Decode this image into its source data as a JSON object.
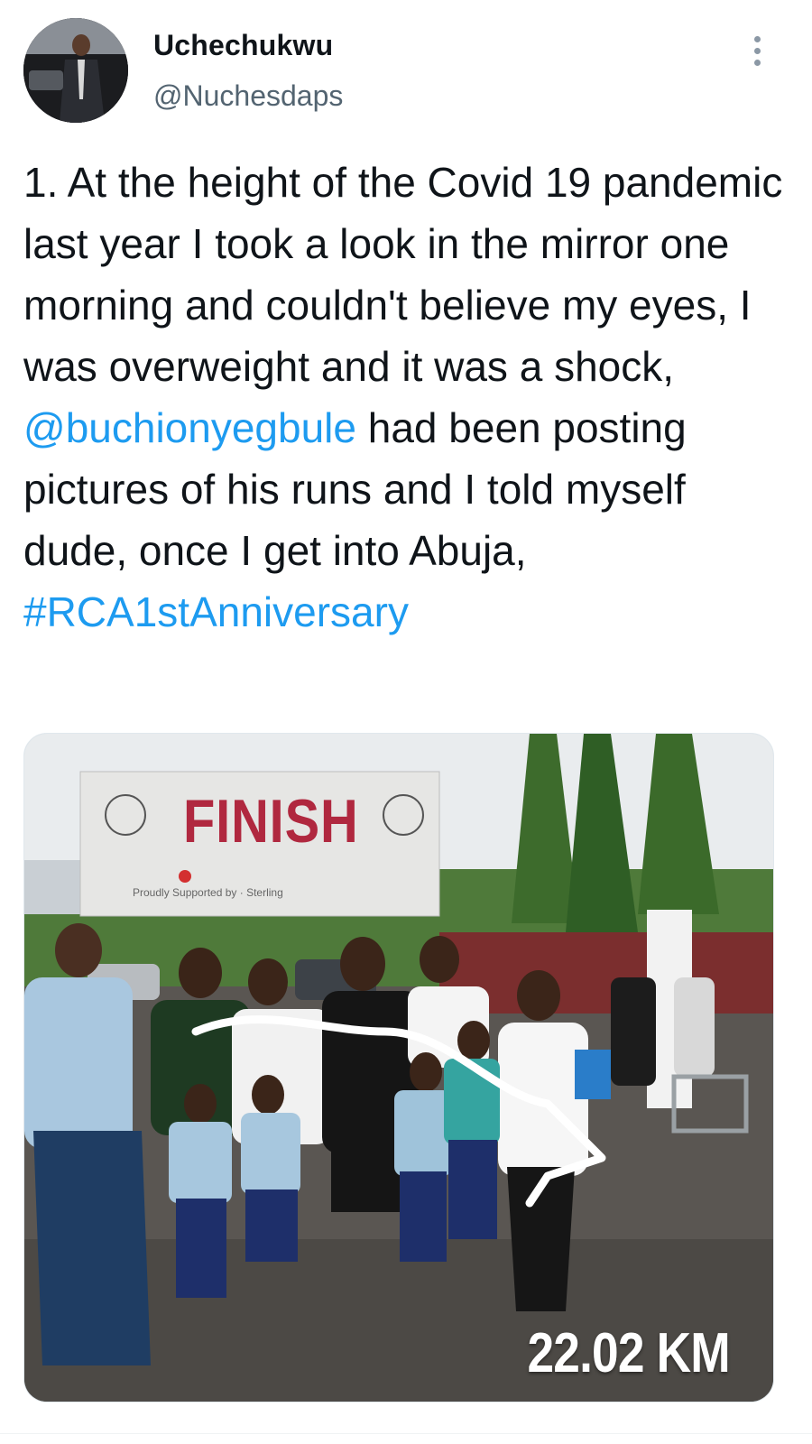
{
  "author": {
    "display_name": "Uchechukwu",
    "handle": "@Nuchesdaps"
  },
  "tweet": {
    "text_intro": "1. At the height of the Covid 19 pandemic last year I took a look in the mirror one morning and couldn't believe my eyes, I was overweight and it was a shock, ",
    "mention": "@buchionyegbule",
    "text_middle": " had been posting pictures of his runs and I told myself dude, once I get into Abuja, ",
    "hashtag": "#RCA1stAnniversary"
  },
  "media": {
    "banner_title": "FINISH",
    "distance_overlay": "22.02 KM"
  },
  "colors": {
    "link": "#1d9bf0",
    "secondary_text": "#536471",
    "primary_text": "#0f1419",
    "banner_red": "#b0283f"
  },
  "icons": {
    "more": "more-vertical-icon"
  }
}
